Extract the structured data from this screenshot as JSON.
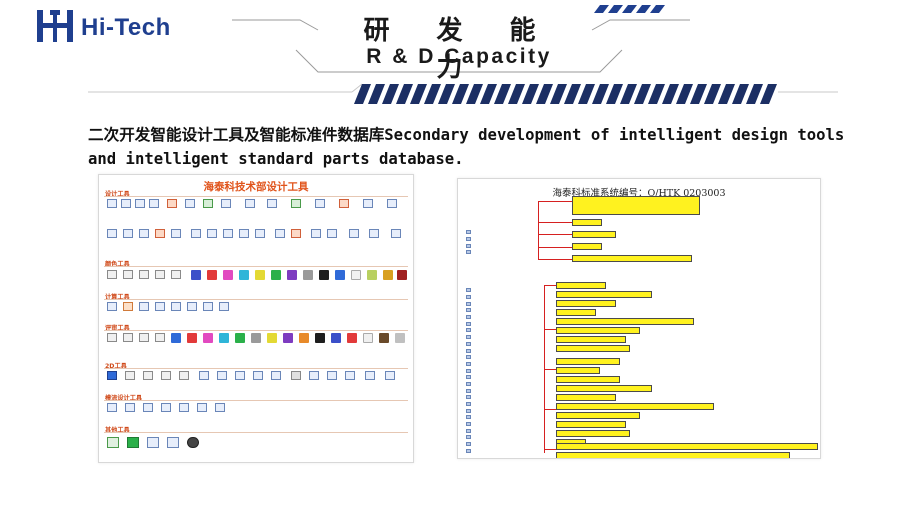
{
  "logo": {
    "brand": "Hi-Tech",
    "mark_icon": "hitech-logo-icon",
    "brand_color": "#1f3f8f"
  },
  "header": {
    "title_cn": "研 发 能 力",
    "title_en": "R & D Capacity",
    "stripe_color": "#1f3f8f"
  },
  "subtitle": "二次开发智能设计工具及智能标准件数据库Secondary development of intelligent design tools and intelligent standard parts database.",
  "left_panel": {
    "title": "海泰科技术部设计工具",
    "accent_color": "#e0531a",
    "sections": [
      "设计工具",
      "颜色工具",
      "计算工具",
      "评审工具",
      "2D工具",
      "模流设计工具",
      "其他工具"
    ]
  },
  "right_panel": {
    "title": "海泰科标准系统编号：Q/HTK 0203003",
    "highlight_color": "#fff21f",
    "line_color": "#d62020"
  }
}
